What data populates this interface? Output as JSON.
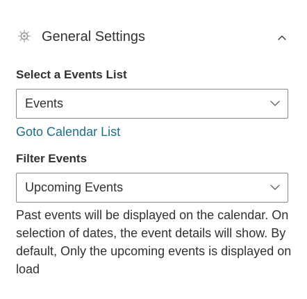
{
  "section": {
    "title": "General Settings",
    "icon": "gear-icon",
    "collapse_icon": "chevron-up-icon"
  },
  "events_list": {
    "label": "Select a Events List",
    "value": "Events",
    "chevron_icon": "chevron-down-icon"
  },
  "calendar_link": {
    "label": "Goto Calendar List"
  },
  "filter": {
    "label": "Filter Events",
    "value": "Upcoming Events",
    "chevron_icon": "chevron-down-icon"
  },
  "description": "Past events will be displayed on the calendar. On selection of dates, the event details will show. By default, Only the upcoming events is displayed on load",
  "colors": {
    "link": "#1b6e8c",
    "border": "#8a8886",
    "text": "#323130"
  }
}
